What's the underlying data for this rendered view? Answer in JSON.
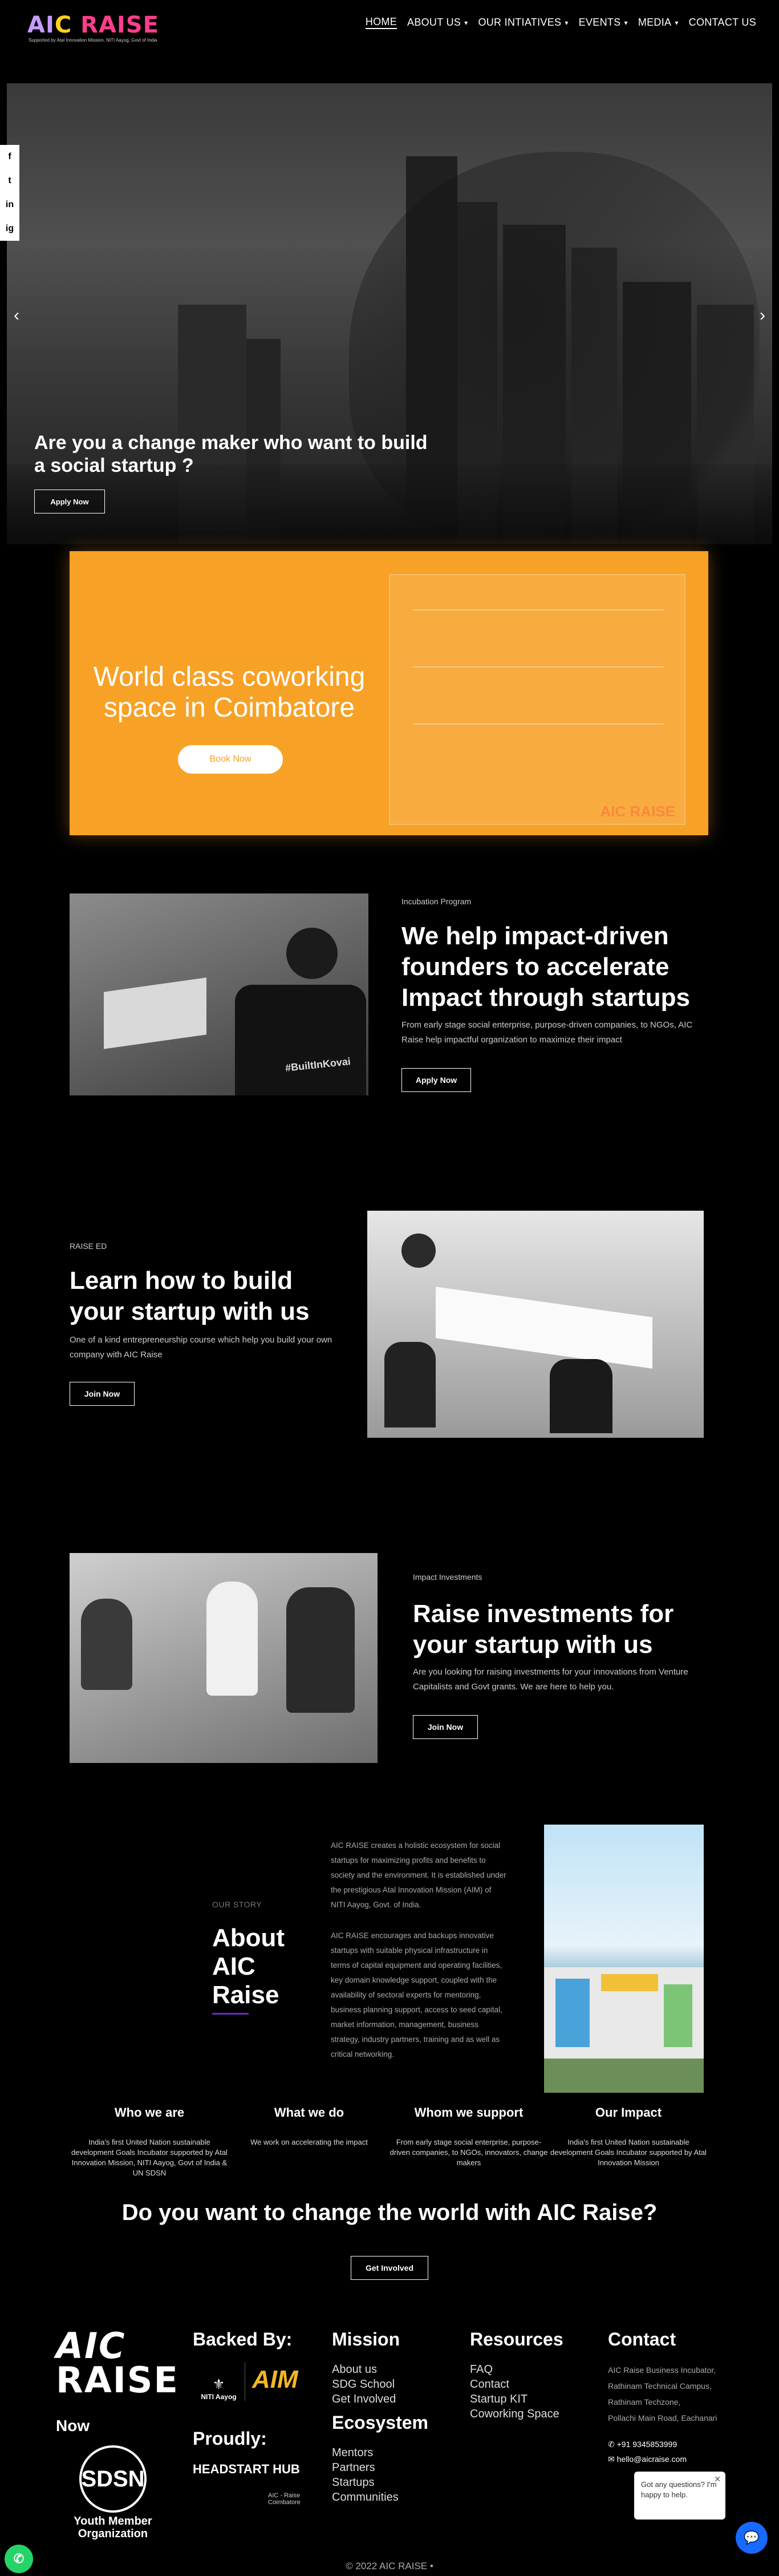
{
  "brand": {
    "logo_ai": "AI",
    "logo_c": "C",
    "logo_raise": "RAISE",
    "tagline": "Supported by Atal Innovation Mission, NITI Aayog, Govt of India"
  },
  "nav": [
    {
      "label": "HOME",
      "caret": false
    },
    {
      "label": "ABOUT US",
      "caret": true
    },
    {
      "label": "OUR INTIATIVES",
      "caret": true
    },
    {
      "label": "EVENTS",
      "caret": true
    },
    {
      "label": "MEDIA",
      "caret": true
    },
    {
      "label": "CONTACT US",
      "caret": false
    }
  ],
  "social": [
    "f",
    "t",
    "in",
    "ig"
  ],
  "hero": {
    "title": "Are you a change maker who want to build a social startup ?",
    "button": "Apply Now",
    "prev": "‹",
    "next": "›"
  },
  "cowork": {
    "title": "World class coworking space in Coimbatore",
    "button": "Book Now",
    "watermark": "AIC RAISE"
  },
  "incubation": {
    "tag": "Incubation Program",
    "title": "We help impact-driven founders to accelerate Impact through startups",
    "text": "From early stage social enterprise, purpose-driven companies, to NGOs, AIC Raise help impactful organization to maximize their impact",
    "button": "Apply Now",
    "shirt_text": "#BuiltInKovai"
  },
  "raise_ed": {
    "tag": "RAISE ED",
    "title": "Learn how to build your startup with us",
    "text": "One of a kind entrepreneurship course which help you build your own company with AIC Raise",
    "button": "Join Now"
  },
  "investments": {
    "tag": "Impact Investments",
    "title": "Raise investments for your startup with us",
    "text": "Are you looking for raising investments for your innovations from Venture Capitalists and Govt grants. We are here to help you.",
    "button": "Join Now"
  },
  "about": {
    "tag": "OUR STORY",
    "title": "About AIC Raise",
    "p1": "AIC RAISE creates a holistic ecosystem for social startups for maximizing profits and benefits to society and the environment. It is established under the prestigious Atal Innovation Mission (AIM) of NITI Aayog, Govt. of India.",
    "p2": "AIC RAISE encourages and backups innovative startups with suitable physical infrastructure in terms of capital equipment and operating facilities, key domain knowledge support, coupled with the availability of sectoral experts for mentoring, business planning support, access to seed capital, market information, management, business strategy, industry partners, training and as well as critical networking."
  },
  "columns": [
    {
      "title": "Who we are",
      "text": "India's first United Nation sustainable development Goals Incubator supported by Atal Innovation Mission, NITI Aayog, Govt of India & UN SDSN"
    },
    {
      "title": "What we do",
      "text": "We work on accelerating the impact"
    },
    {
      "title": "Whom we support",
      "text": "From early stage social enterprise, purpose-driven companies, to NGOs, innovators, change makers"
    },
    {
      "title": "Our Impact",
      "text": "India's first United Nation sustainable development Goals Incubator supported by Atal Innovation Mission"
    }
  ],
  "cta": {
    "title": "Do you want to change the world with AIC Raise?",
    "button": "Get Involved"
  },
  "footer": {
    "logo_top": "AIC",
    "logo_bottom": "RAISE",
    "now": "Now",
    "sdsn": "SDSN",
    "sdsn_sub": "Youth Member Organization",
    "backed_by": "Backed By:",
    "niti": "NITI Aayog",
    "aim": "AIM",
    "proudly": "Proudly:",
    "headstart": "HEADSTART HUB",
    "headstart_sub": "AIC - Raise Coimbatore",
    "mission": {
      "title": "Mission",
      "links": [
        "About us",
        "SDG School",
        "Get Involved"
      ]
    },
    "ecosystem": {
      "title": "Ecosystem",
      "links": [
        "Mentors",
        "Partners",
        "Startups",
        "Communities"
      ]
    },
    "resources": {
      "title": "Resources",
      "links": [
        "FAQ",
        "Contact",
        "Startup KIT",
        "Coworking Space"
      ]
    },
    "contact": {
      "title": "Contact",
      "address": [
        "AIC Raise Business Incubator,",
        "Rathinam Technical Campus,",
        "Rathinam Techzone,",
        "Pollachi Main Road, Eachanari"
      ],
      "phone": "+91 9345853999",
      "email": "hello@aicraise.com"
    },
    "copyright": "© 2022 AIC RAISE •"
  },
  "chat": {
    "message": "Got any questions? I'm happy to help."
  },
  "colors": {
    "orange": "#f7a126",
    "purple": "#6a2bc9",
    "chat_blue": "#1769ff",
    "whatsapp": "#25d366"
  }
}
